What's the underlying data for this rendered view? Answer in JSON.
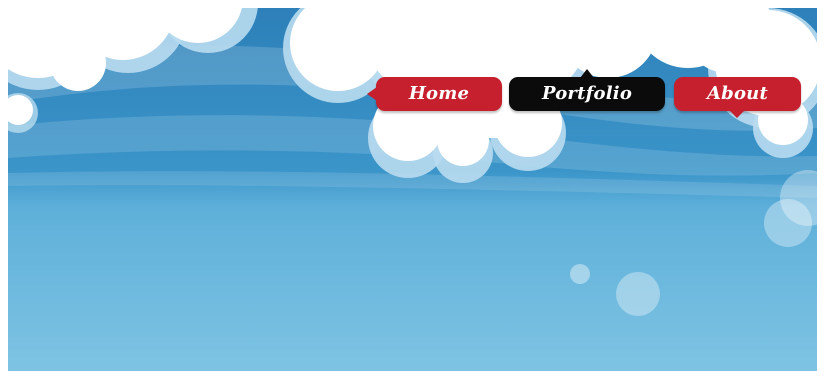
{
  "nav": {
    "items": [
      {
        "label": "Home",
        "color": "#c61f2d"
      },
      {
        "label": "Portfolio",
        "color": "#0b0b0b"
      },
      {
        "label": "About",
        "color": "#c61f2d"
      }
    ]
  },
  "colors": {
    "sky_top": "#2f84bd",
    "sky_bottom": "#7cc0e0",
    "cloud": "#ffffff",
    "cloud_edge": "#b9dcef",
    "menu_red": "#c61f2d",
    "menu_black": "#0b0b0b"
  }
}
